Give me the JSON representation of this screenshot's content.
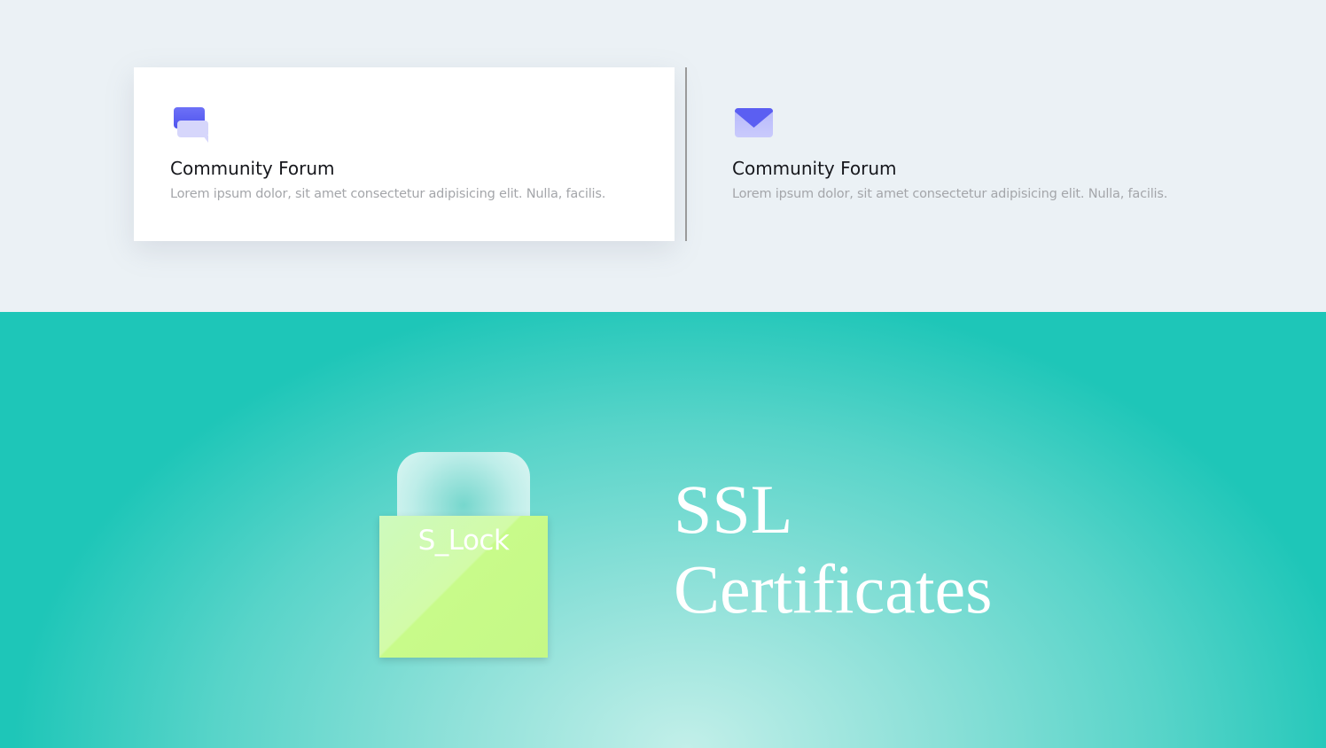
{
  "features": {
    "cards": [
      {
        "icon": "chat-bubbles-icon",
        "title": "Community Forum",
        "text": "Lorem ipsum dolor, sit amet consectetur adipisicing elit. Nulla, facilis.",
        "active": true
      },
      {
        "icon": "envelope-icon",
        "title": "Community Forum",
        "text": "Lorem ipsum dolor, sit amet consectetur adipisicing elit. Nulla, facilis.",
        "active": false
      }
    ]
  },
  "hero": {
    "lock_label": "S_Lock",
    "title_line1": "SSL",
    "title_line2": "Certificates"
  },
  "colors": {
    "top_background": "#ebf1f5",
    "accent_purple": "#5b5ff2",
    "teal": "#1ec6b8",
    "lock_green": "#c8fb8a"
  }
}
